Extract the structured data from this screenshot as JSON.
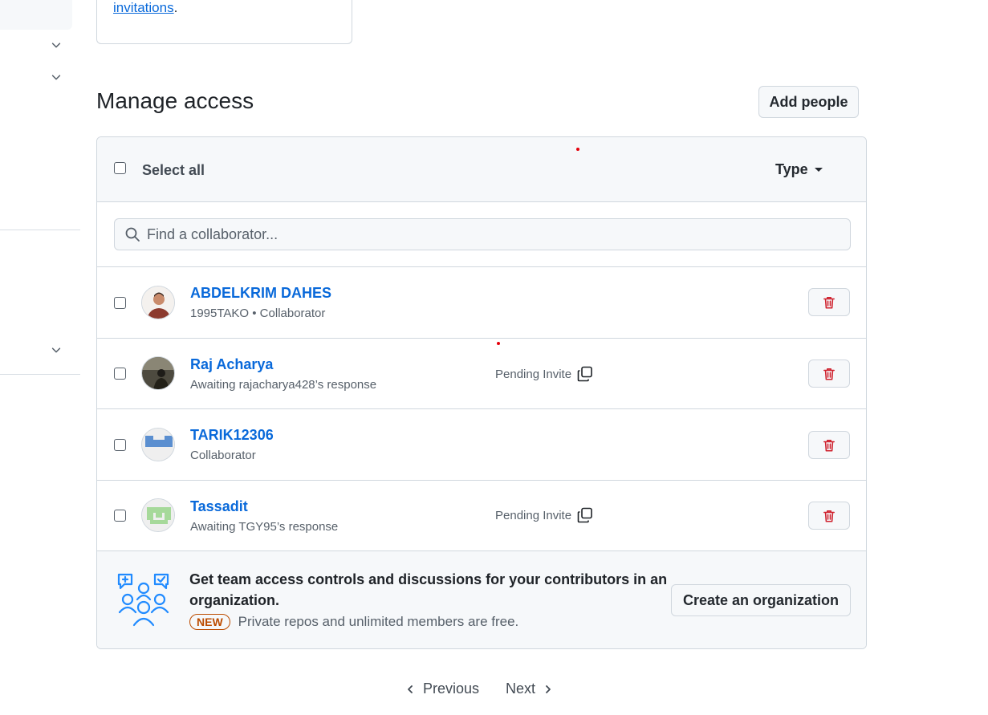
{
  "invite_card": {
    "link_text": "invitations",
    "trailing": "."
  },
  "page": {
    "title": "Manage access",
    "add_people_label": "Add people"
  },
  "table": {
    "select_all_label": "Select all",
    "type_filter_label": "Type",
    "search_placeholder": "Find a collaborator...",
    "rows": [
      {
        "name": "ABDELKRIM DAHES",
        "subtitle": "1995TAKO • Collaborator",
        "pending": ""
      },
      {
        "name": "Raj Acharya",
        "subtitle": "Awaiting rajacharya428’s response",
        "pending": "Pending Invite"
      },
      {
        "name": "TARIK12306",
        "subtitle": "Collaborator",
        "pending": ""
      },
      {
        "name": "Tassadit",
        "subtitle": "Awaiting TGY95’s response",
        "pending": "Pending Invite"
      }
    ]
  },
  "promo": {
    "title": "Get team access controls and discussions for your contributors in an organization.",
    "badge": "NEW",
    "subtitle": "Private repos and unlimited members are free.",
    "button_label": "Create an organization"
  },
  "pagination": {
    "previous_label": "Previous",
    "next_label": "Next"
  },
  "colors": {
    "link": "#0969da",
    "danger": "#cf222e",
    "badge": "#bc4c00"
  }
}
